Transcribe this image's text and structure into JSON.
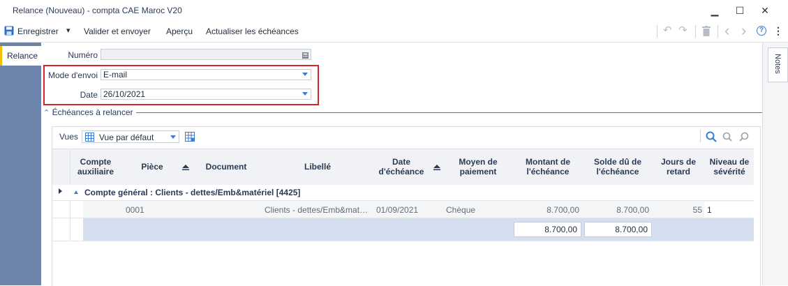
{
  "window": {
    "title": "Relance (Nouveau) - compta CAE Maroc V20",
    "minimize": "▁",
    "maximize": "☐",
    "close": "✕"
  },
  "toolbar": {
    "save_label": "Enregistrer",
    "save_dropdown": "▾",
    "validate_label": "Valider et envoyer",
    "preview_label": "Aperçu",
    "refresh_label": "Actualiser les échéances",
    "undo_icon": "↶",
    "redo_icon": "↷",
    "delete_icon": "🗑",
    "prev_icon": "‹",
    "next_icon": "›",
    "help_icon": "?",
    "more_icon": "⋮"
  },
  "tabs": {
    "left": "Relance",
    "notes": "Notes"
  },
  "form": {
    "numero_label": "Numéro",
    "numero_value": "",
    "mode_label": "Mode d'envoi",
    "mode_value": "E-mail",
    "date_label": "Date",
    "date_value": "26/10/2021"
  },
  "section": {
    "title": "Échéances à relancer",
    "toggle": "⌃"
  },
  "grid": {
    "vues_label": "Vues",
    "vue_value": "Vue par défaut",
    "columns": [
      "Compte auxiliaire",
      "Pièce",
      "Document",
      "Libellé",
      "Date d'échéance",
      "Moyen de paiement",
      "Montant de l'échéance",
      "Solde dû de l'échéance",
      "Jours de retard",
      "Niveau de sévérité"
    ],
    "group_label": "Compte général : Clients - dettes/Emb&matériel [4425]",
    "row": {
      "compte": "",
      "piece": "0001",
      "document": "",
      "libelle": "Clients - dettes/Emb&matériel",
      "date": "01/09/2021",
      "moyen": "Chèque",
      "montant": "8.700,00",
      "solde": "8.700,00",
      "jours": "55",
      "niveau": "1"
    },
    "totals": {
      "montant": "8.700,00",
      "solde": "8.700,00"
    }
  }
}
